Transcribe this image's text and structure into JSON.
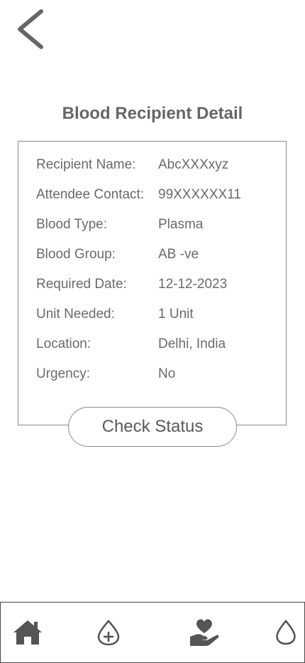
{
  "header": {
    "back_icon": "chevron-left-icon"
  },
  "page": {
    "title": "Blood Recipient Detail"
  },
  "details": [
    {
      "label": "Recipient Name:",
      "value": "AbcXXXxyz"
    },
    {
      "label": "Attendee Contact:",
      "value": "99XXXXXX11"
    },
    {
      "label": "Blood Type:",
      "value": "Plasma"
    },
    {
      "label": "Blood Group:",
      "value": "AB -ve"
    },
    {
      "label": "Required Date:",
      "value": "12-12-2023"
    },
    {
      "label": "Unit Needed:",
      "value": "1 Unit"
    },
    {
      "label": "Location:",
      "value": "Delhi, India"
    },
    {
      "label": "Urgency:",
      "value": "No"
    }
  ],
  "actions": {
    "check_status_label": "Check Status"
  },
  "bottom_nav": {
    "items": [
      {
        "icon": "home-icon"
      },
      {
        "icon": "blood-drop-plus-icon"
      },
      {
        "icon": "hand-heart-icon"
      },
      {
        "icon": "blood-drop-icon"
      }
    ]
  },
  "colors": {
    "text": "#666666",
    "icon": "#555555",
    "border": "#8a8a8a"
  }
}
